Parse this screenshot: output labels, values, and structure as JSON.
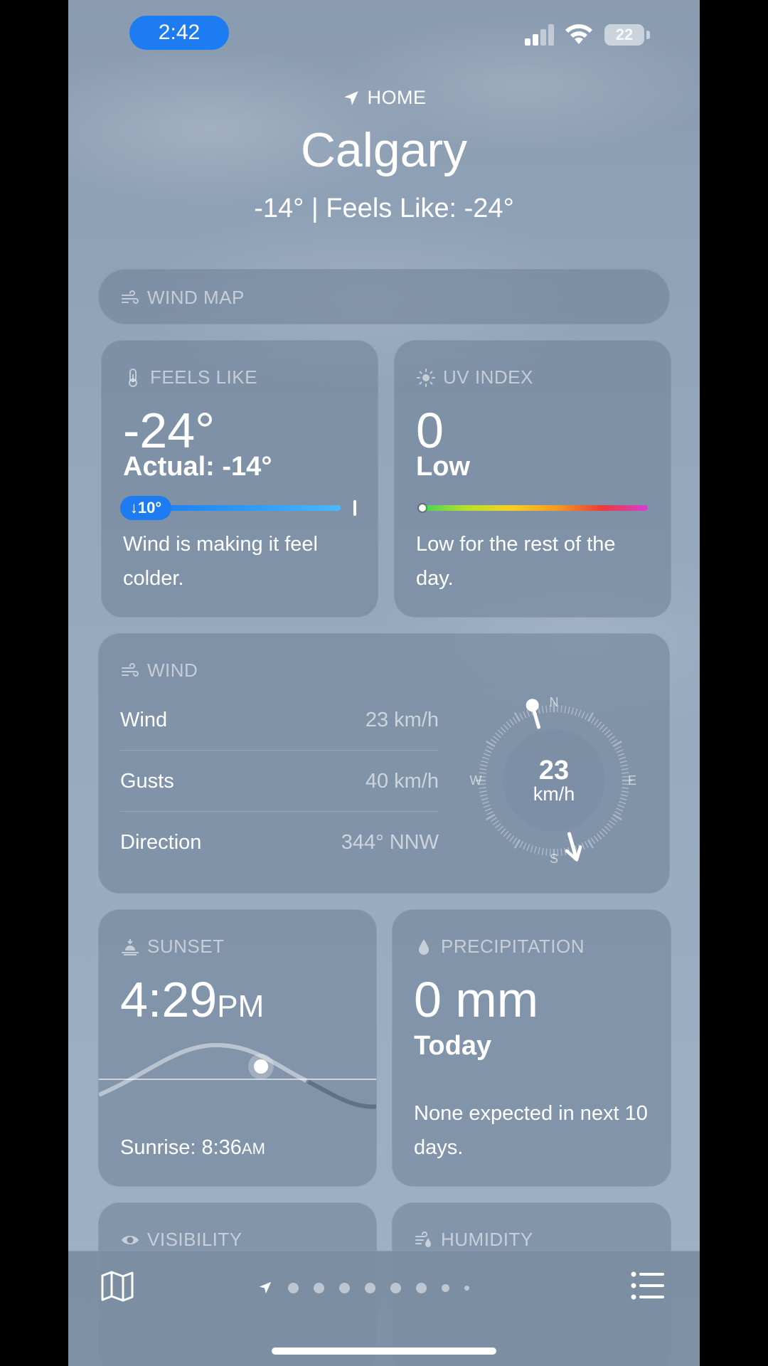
{
  "status_bar": {
    "time": "2:42",
    "battery": "22",
    "icons": [
      "cellular-signal-icon",
      "wifi-icon",
      "battery-icon"
    ]
  },
  "header": {
    "location_tag": "HOME",
    "city": "Calgary",
    "temps": "-14° | Feels Like: -24°"
  },
  "wind_map": {
    "label": "WIND MAP",
    "icon": "wind-icon"
  },
  "feels_like": {
    "label": "FEELS LIKE",
    "icon": "thermometer-icon",
    "value": "-24°",
    "actual": "Actual: -14°",
    "difference_badge": "↓10°",
    "description": "Wind is making it feel colder."
  },
  "uv_index": {
    "label": "UV INDEX",
    "icon": "sun-icon",
    "value": "0",
    "level": "Low",
    "level_fraction": 0,
    "description": "Low for the rest of the day."
  },
  "wind": {
    "label": "WIND",
    "icon": "wind-icon",
    "rows": [
      {
        "key": "Wind",
        "value": "23 km/h"
      },
      {
        "key": "Gusts",
        "value": "40 km/h"
      },
      {
        "key": "Direction",
        "value": "344° NNW"
      }
    ],
    "compass": {
      "speed": "23",
      "unit": "km/h",
      "direction_degrees": 344,
      "cardinals": {
        "n": "N",
        "e": "E",
        "s": "S",
        "w": "W"
      }
    }
  },
  "sunset": {
    "label": "SUNSET",
    "icon": "sunset-icon",
    "time": "4:29",
    "time_ampm": "PM",
    "sunrise_prefix": "Sunrise: 8:36",
    "sunrise_ampm": "AM"
  },
  "precipitation": {
    "label": "PRECIPITATION",
    "icon": "droplet-icon",
    "value": "0 mm",
    "period": "Today",
    "description": "None expected in next 10 days."
  },
  "visibility": {
    "label": "VISIBILITY",
    "icon": "eye-icon"
  },
  "humidity": {
    "label": "HUMIDITY",
    "icon": "humidity-icon"
  },
  "toolbar": {
    "map_icon": "map-icon",
    "list_icon": "list-icon",
    "page_count": 9,
    "current_page": 0
  },
  "colors": {
    "accent_blue": "#1e7cf2",
    "card_bg": "rgba(110,128,150,0.55)"
  }
}
